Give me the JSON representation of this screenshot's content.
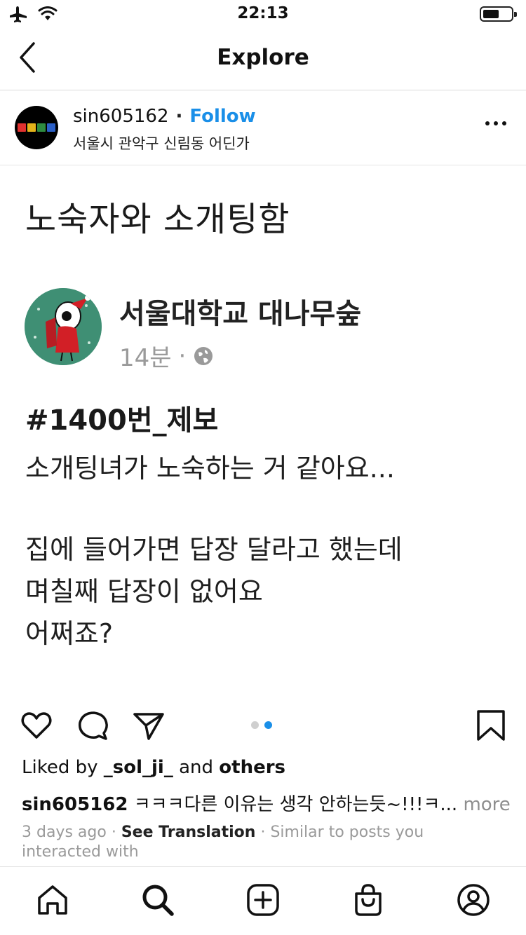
{
  "status_bar": {
    "time": "22:13",
    "icons": [
      "airplane-icon",
      "wifi-icon",
      "battery-icon"
    ]
  },
  "nav": {
    "title": "Explore",
    "back_icon": "chevron-left-icon"
  },
  "post": {
    "username": "sin605162",
    "separator": "·",
    "follow_label": "Follow",
    "location": "서울시 관악구 신림동 어딘가",
    "more_icon": "more-horizontal-icon"
  },
  "image": {
    "title": "노숙자와 소개팅함",
    "page_name": "서울대학교 대나무숲",
    "time_ago": "14분",
    "meta_separator": "·",
    "tag": "#1400번_제보",
    "lines": [
      "소개팅녀가 노숙하는 거 같아요...",
      "집에 들어가면 답장 달라고 했는데",
      "며칠째 답장이 없어요",
      "어쩌죠?"
    ]
  },
  "actions": {
    "icons": [
      "heart-icon",
      "comment-icon",
      "share-icon",
      "bookmark-icon"
    ],
    "carousel_total": 2,
    "carousel_active": 2
  },
  "likes": {
    "prefix": "Liked by",
    "user": "_sol_ji_",
    "middle": "and",
    "others": "others"
  },
  "caption": {
    "username": "sin605162",
    "text": "ㅋㅋㅋ다른 이유는 생각 안하는듯~!!!ㅋ...",
    "more": "more"
  },
  "meta": {
    "time": "3 days ago",
    "dot": "·",
    "translation": "See Translation",
    "dot2": "·",
    "similar": "Similar to posts you interacted with"
  },
  "tabbar": {
    "icons": [
      "home-icon",
      "search-icon",
      "new-post-icon",
      "shop-icon",
      "profile-icon"
    ]
  },
  "colors": {
    "accent": "#1a8fe8",
    "muted_text": "#9a9a9a",
    "divider": "#dbdbdb"
  }
}
